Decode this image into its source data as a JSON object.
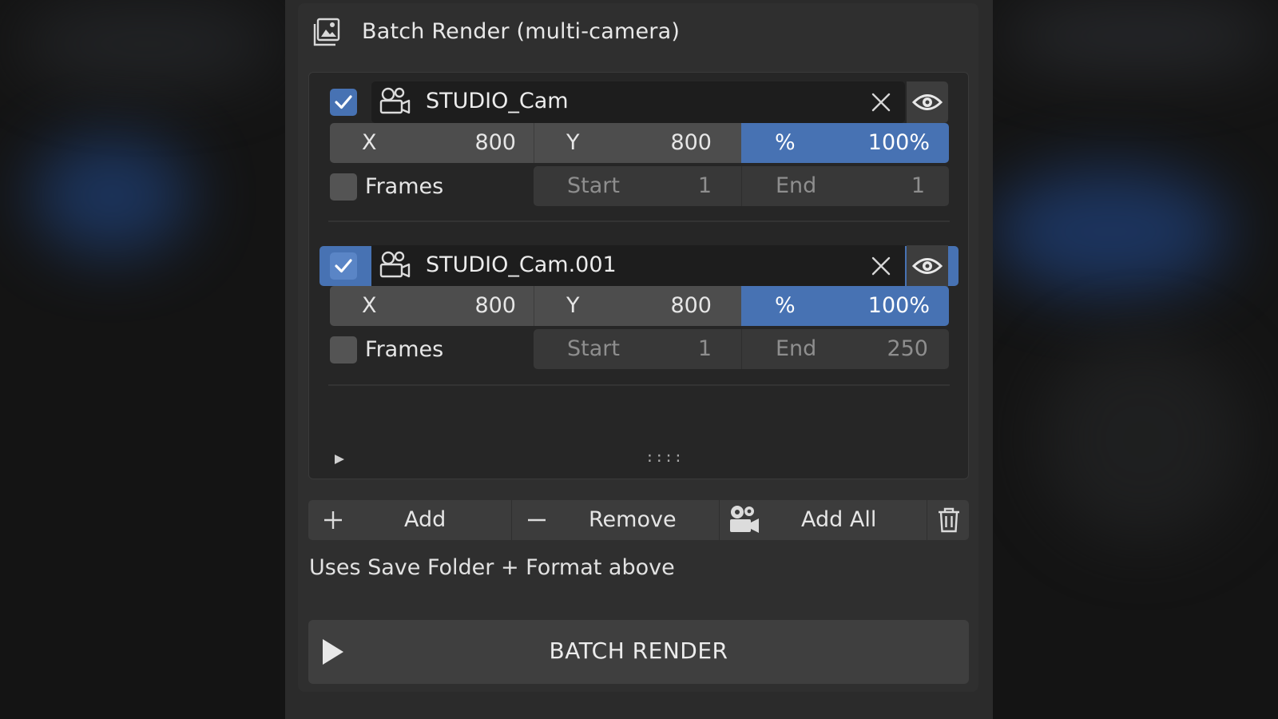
{
  "panel": {
    "title": "Batch Render (multi-camera)",
    "icon": "render-images-icon"
  },
  "cameras": [
    {
      "enabled": true,
      "name": "STUDIO_Cam",
      "x_label": "X",
      "x_value": "800",
      "y_label": "Y",
      "y_value": "800",
      "pct_label": "%",
      "pct_value": "100%",
      "frames_enabled": false,
      "frames_label": "Frames",
      "start_label": "Start",
      "start_value": "1",
      "end_label": "End",
      "end_value": "1",
      "selected": false
    },
    {
      "enabled": true,
      "name": "STUDIO_Cam.001",
      "x_label": "X",
      "x_value": "800",
      "y_label": "Y",
      "y_value": "800",
      "pct_label": "%",
      "pct_value": "100%",
      "frames_enabled": false,
      "frames_label": "Frames",
      "start_label": "Start",
      "start_value": "1",
      "end_label": "End",
      "end_value": "250",
      "selected": true
    }
  ],
  "list": {
    "expand_icon": "triangle-right-icon",
    "resize_handle": "::::"
  },
  "toolbar": {
    "add_label": "Add",
    "remove_label": "Remove",
    "add_all_label": "Add All",
    "trash_icon": "trash-icon"
  },
  "description": "Uses Save Folder + Format above",
  "render_button": {
    "label": "BATCH RENDER",
    "icon": "play-icon"
  },
  "colors": {
    "accent": "#4772b3",
    "panel": "#2f2f2f",
    "field": "#4d4d4d"
  }
}
